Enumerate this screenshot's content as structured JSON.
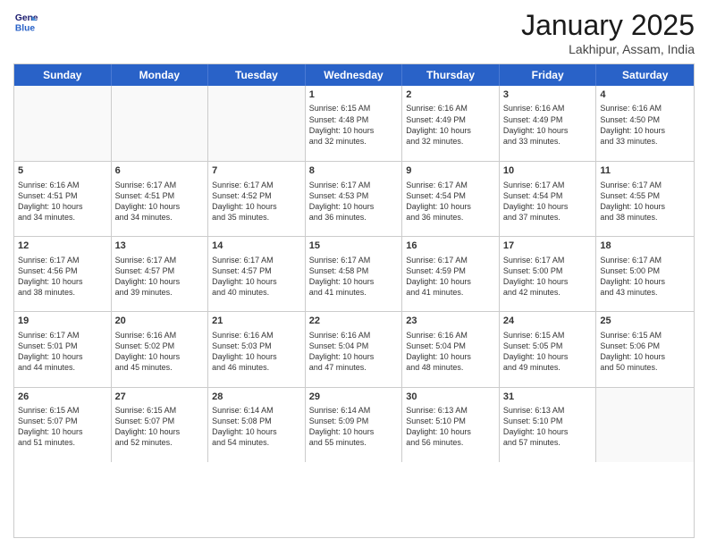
{
  "header": {
    "logo_line1": "General",
    "logo_line2": "Blue",
    "month": "January 2025",
    "location": "Lakhipur, Assam, India"
  },
  "day_headers": [
    "Sunday",
    "Monday",
    "Tuesday",
    "Wednesday",
    "Thursday",
    "Friday",
    "Saturday"
  ],
  "weeks": [
    [
      {
        "day": "",
        "info": "",
        "empty": true
      },
      {
        "day": "",
        "info": "",
        "empty": true
      },
      {
        "day": "",
        "info": "",
        "empty": true
      },
      {
        "day": "1",
        "info": "Sunrise: 6:15 AM\nSunset: 4:48 PM\nDaylight: 10 hours\nand 32 minutes.",
        "empty": false
      },
      {
        "day": "2",
        "info": "Sunrise: 6:16 AM\nSunset: 4:49 PM\nDaylight: 10 hours\nand 32 minutes.",
        "empty": false
      },
      {
        "day": "3",
        "info": "Sunrise: 6:16 AM\nSunset: 4:49 PM\nDaylight: 10 hours\nand 33 minutes.",
        "empty": false
      },
      {
        "day": "4",
        "info": "Sunrise: 6:16 AM\nSunset: 4:50 PM\nDaylight: 10 hours\nand 33 minutes.",
        "empty": false
      }
    ],
    [
      {
        "day": "5",
        "info": "Sunrise: 6:16 AM\nSunset: 4:51 PM\nDaylight: 10 hours\nand 34 minutes.",
        "empty": false
      },
      {
        "day": "6",
        "info": "Sunrise: 6:17 AM\nSunset: 4:51 PM\nDaylight: 10 hours\nand 34 minutes.",
        "empty": false
      },
      {
        "day": "7",
        "info": "Sunrise: 6:17 AM\nSunset: 4:52 PM\nDaylight: 10 hours\nand 35 minutes.",
        "empty": false
      },
      {
        "day": "8",
        "info": "Sunrise: 6:17 AM\nSunset: 4:53 PM\nDaylight: 10 hours\nand 36 minutes.",
        "empty": false
      },
      {
        "day": "9",
        "info": "Sunrise: 6:17 AM\nSunset: 4:54 PM\nDaylight: 10 hours\nand 36 minutes.",
        "empty": false
      },
      {
        "day": "10",
        "info": "Sunrise: 6:17 AM\nSunset: 4:54 PM\nDaylight: 10 hours\nand 37 minutes.",
        "empty": false
      },
      {
        "day": "11",
        "info": "Sunrise: 6:17 AM\nSunset: 4:55 PM\nDaylight: 10 hours\nand 38 minutes.",
        "empty": false
      }
    ],
    [
      {
        "day": "12",
        "info": "Sunrise: 6:17 AM\nSunset: 4:56 PM\nDaylight: 10 hours\nand 38 minutes.",
        "empty": false
      },
      {
        "day": "13",
        "info": "Sunrise: 6:17 AM\nSunset: 4:57 PM\nDaylight: 10 hours\nand 39 minutes.",
        "empty": false
      },
      {
        "day": "14",
        "info": "Sunrise: 6:17 AM\nSunset: 4:57 PM\nDaylight: 10 hours\nand 40 minutes.",
        "empty": false
      },
      {
        "day": "15",
        "info": "Sunrise: 6:17 AM\nSunset: 4:58 PM\nDaylight: 10 hours\nand 41 minutes.",
        "empty": false
      },
      {
        "day": "16",
        "info": "Sunrise: 6:17 AM\nSunset: 4:59 PM\nDaylight: 10 hours\nand 41 minutes.",
        "empty": false
      },
      {
        "day": "17",
        "info": "Sunrise: 6:17 AM\nSunset: 5:00 PM\nDaylight: 10 hours\nand 42 minutes.",
        "empty": false
      },
      {
        "day": "18",
        "info": "Sunrise: 6:17 AM\nSunset: 5:00 PM\nDaylight: 10 hours\nand 43 minutes.",
        "empty": false
      }
    ],
    [
      {
        "day": "19",
        "info": "Sunrise: 6:17 AM\nSunset: 5:01 PM\nDaylight: 10 hours\nand 44 minutes.",
        "empty": false
      },
      {
        "day": "20",
        "info": "Sunrise: 6:16 AM\nSunset: 5:02 PM\nDaylight: 10 hours\nand 45 minutes.",
        "empty": false
      },
      {
        "day": "21",
        "info": "Sunrise: 6:16 AM\nSunset: 5:03 PM\nDaylight: 10 hours\nand 46 minutes.",
        "empty": false
      },
      {
        "day": "22",
        "info": "Sunrise: 6:16 AM\nSunset: 5:04 PM\nDaylight: 10 hours\nand 47 minutes.",
        "empty": false
      },
      {
        "day": "23",
        "info": "Sunrise: 6:16 AM\nSunset: 5:04 PM\nDaylight: 10 hours\nand 48 minutes.",
        "empty": false
      },
      {
        "day": "24",
        "info": "Sunrise: 6:15 AM\nSunset: 5:05 PM\nDaylight: 10 hours\nand 49 minutes.",
        "empty": false
      },
      {
        "day": "25",
        "info": "Sunrise: 6:15 AM\nSunset: 5:06 PM\nDaylight: 10 hours\nand 50 minutes.",
        "empty": false
      }
    ],
    [
      {
        "day": "26",
        "info": "Sunrise: 6:15 AM\nSunset: 5:07 PM\nDaylight: 10 hours\nand 51 minutes.",
        "empty": false
      },
      {
        "day": "27",
        "info": "Sunrise: 6:15 AM\nSunset: 5:07 PM\nDaylight: 10 hours\nand 52 minutes.",
        "empty": false
      },
      {
        "day": "28",
        "info": "Sunrise: 6:14 AM\nSunset: 5:08 PM\nDaylight: 10 hours\nand 54 minutes.",
        "empty": false
      },
      {
        "day": "29",
        "info": "Sunrise: 6:14 AM\nSunset: 5:09 PM\nDaylight: 10 hours\nand 55 minutes.",
        "empty": false
      },
      {
        "day": "30",
        "info": "Sunrise: 6:13 AM\nSunset: 5:10 PM\nDaylight: 10 hours\nand 56 minutes.",
        "empty": false
      },
      {
        "day": "31",
        "info": "Sunrise: 6:13 AM\nSunset: 5:10 PM\nDaylight: 10 hours\nand 57 minutes.",
        "empty": false
      },
      {
        "day": "",
        "info": "",
        "empty": true
      }
    ]
  ]
}
